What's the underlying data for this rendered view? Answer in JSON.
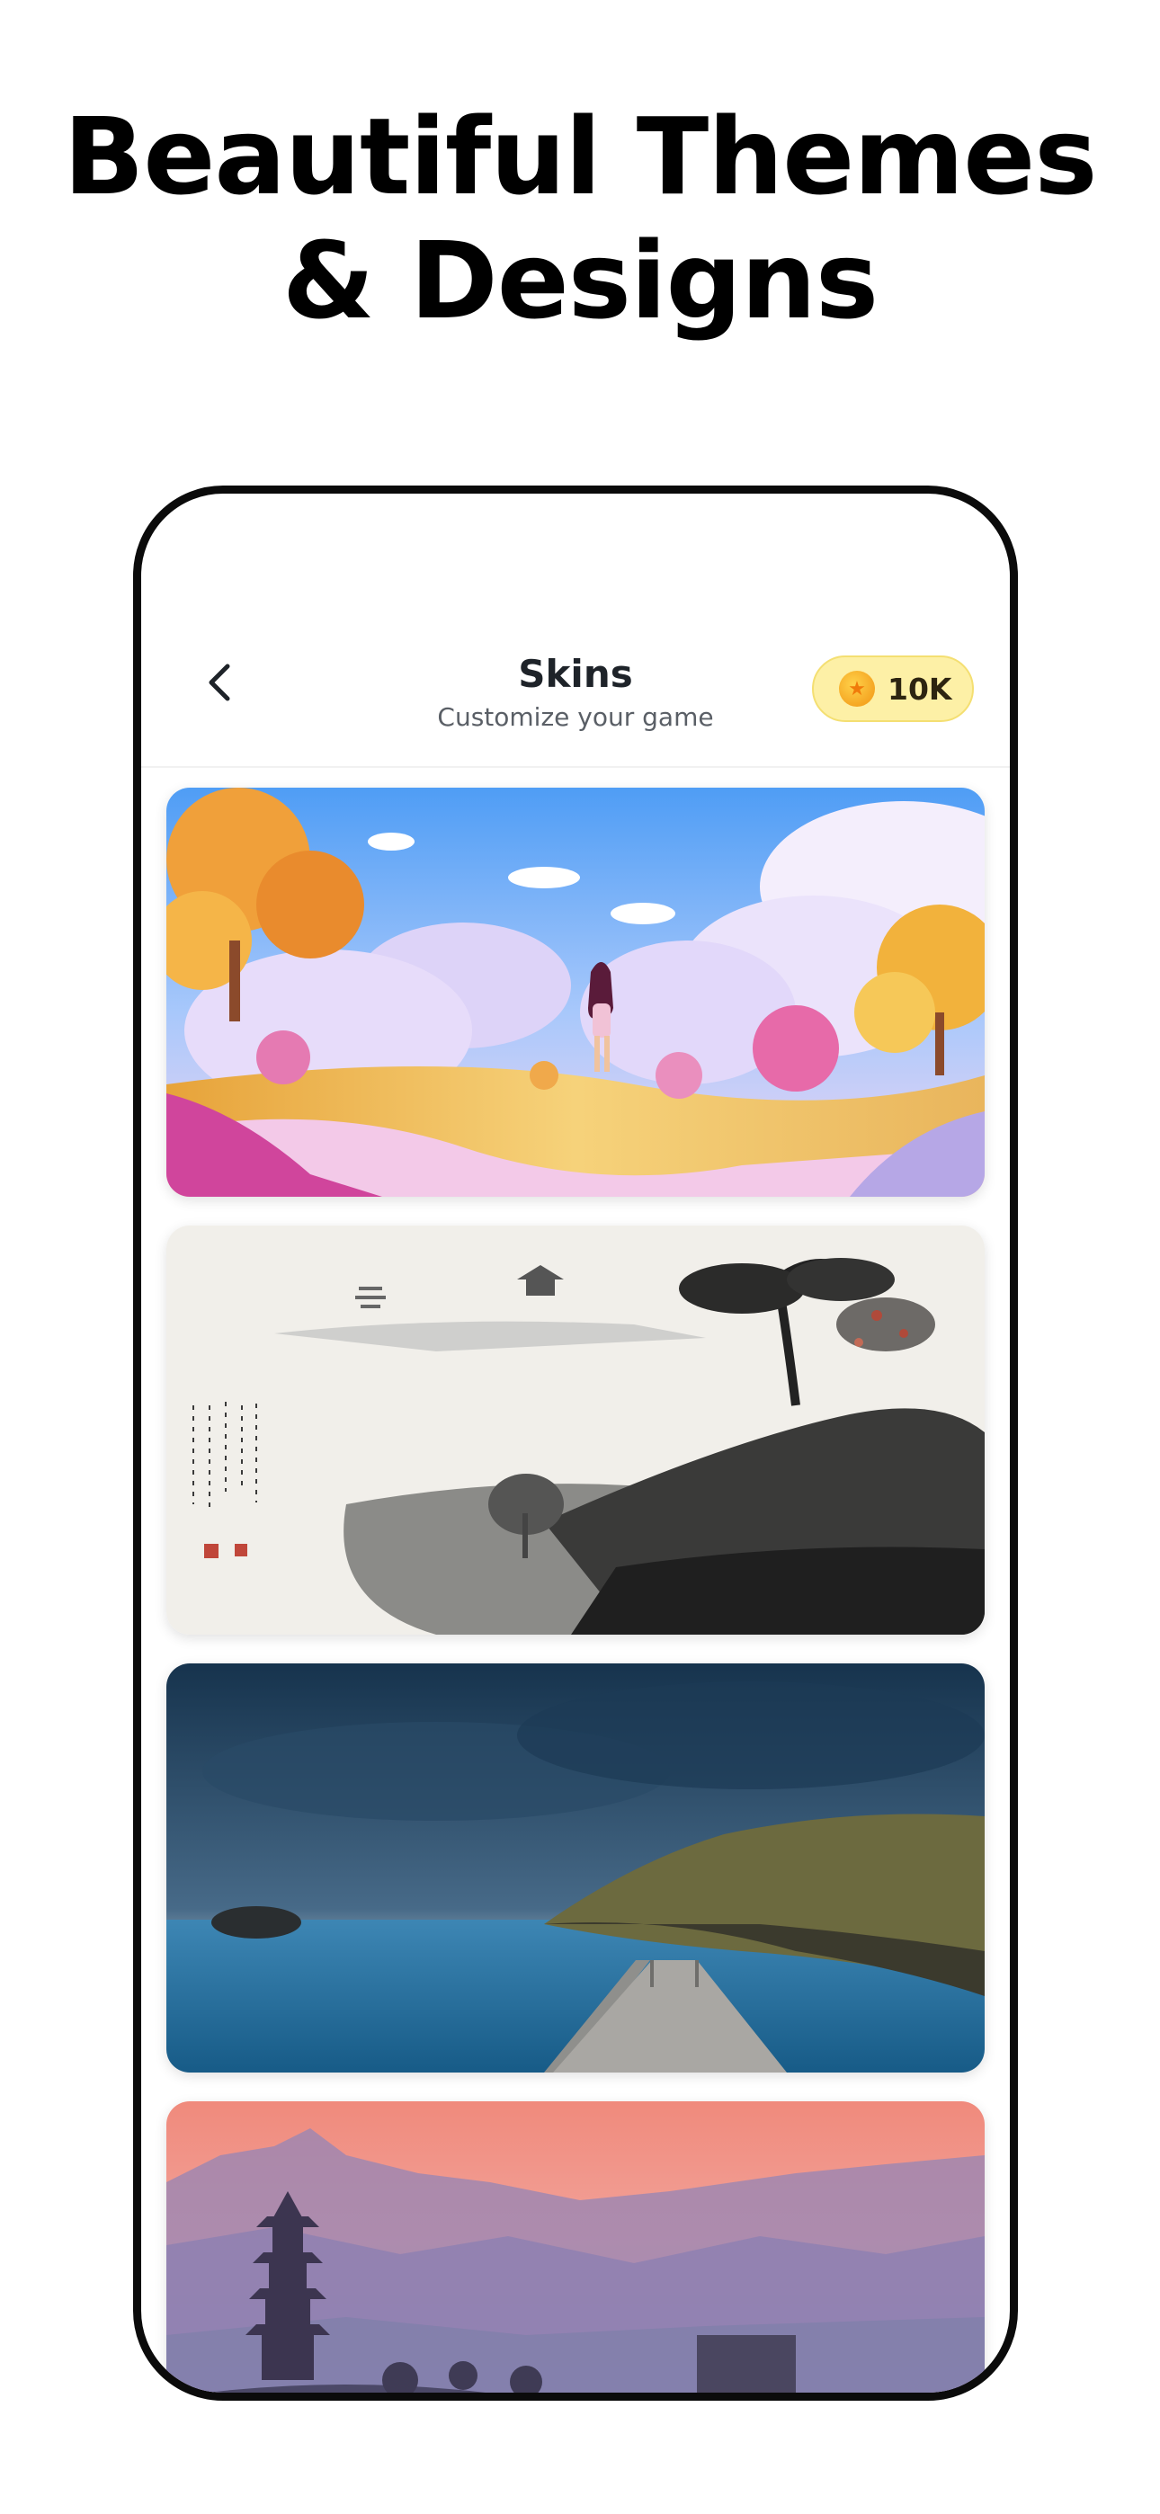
{
  "headline": {
    "line1": "Beautiful Themes",
    "line2": "& Designs"
  },
  "header": {
    "title": "Skins",
    "subtitle": "Customize your game",
    "coins": "10K"
  },
  "icons": {
    "back": "chevron-left-icon",
    "coin": "coin-icon"
  },
  "colors": {
    "coin_pill_bg": "#fdf0a6",
    "coin_pill_border": "#f4df72",
    "title": "#1e2329"
  },
  "skins": [
    {
      "theme": "fantasy-anime-landscape"
    },
    {
      "theme": "ink-wash-landscape"
    },
    {
      "theme": "ocean-pier-dusk"
    },
    {
      "theme": "misty-pagoda-sunset"
    }
  ]
}
